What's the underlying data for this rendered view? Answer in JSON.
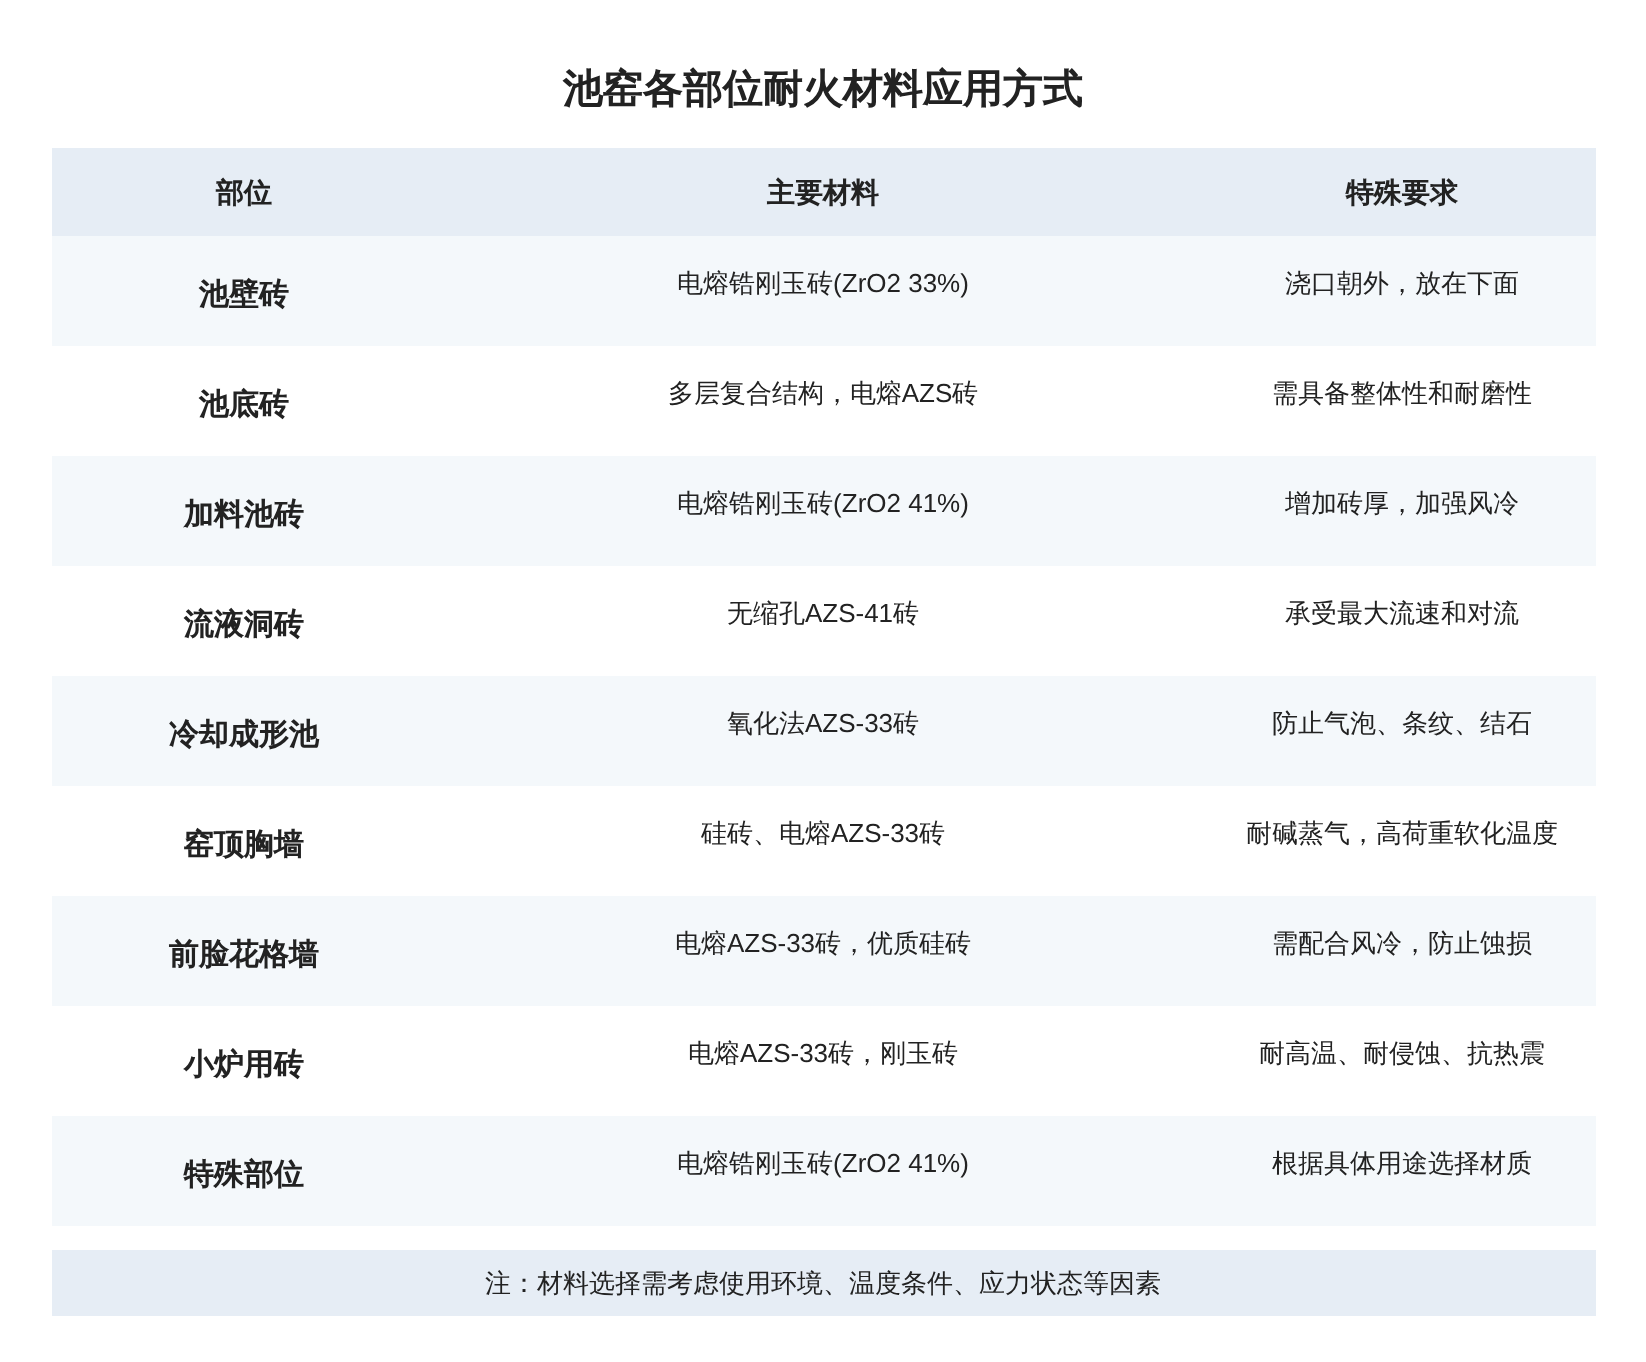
{
  "title": "池窑各部位耐火材料应用方式",
  "table": {
    "columns": [
      "部位",
      "主要材料",
      "特殊要求"
    ],
    "rows": [
      {
        "part": "池壁砖",
        "material": "电熔锆刚玉砖(ZrO2 33%)",
        "requirement": "浇口朝外，放在下面"
      },
      {
        "part": "池底砖",
        "material": "多层复合结构，电熔AZS砖",
        "requirement": "需具备整体性和耐磨性"
      },
      {
        "part": "加料池砖",
        "material": "电熔锆刚玉砖(ZrO2 41%)",
        "requirement": "增加砖厚，加强风冷"
      },
      {
        "part": "流液洞砖",
        "material": "无缩孔AZS-41砖",
        "requirement": "承受最大流速和对流"
      },
      {
        "part": "冷却成形池",
        "material": "氧化法AZS-33砖",
        "requirement": "防止气泡、条纹、结石"
      },
      {
        "part": "窑顶胸墙",
        "material": "硅砖、电熔AZS-33砖",
        "requirement": "耐碱蒸气，高荷重软化温度"
      },
      {
        "part": "前脸花格墙",
        "material": "电熔AZS-33砖，优质硅砖",
        "requirement": "需配合风冷，防止蚀损"
      },
      {
        "part": "小炉用砖",
        "material": "电熔AZS-33砖，刚玉砖",
        "requirement": "耐高温、耐侵蚀、抗热震"
      },
      {
        "part": "特殊部位",
        "material": "电熔锆刚玉砖(ZrO2 41%)",
        "requirement": "根据具体用途选择材质"
      }
    ]
  },
  "note": "注：材料选择需考虑使用环境、温度条件、应力状态等因素"
}
